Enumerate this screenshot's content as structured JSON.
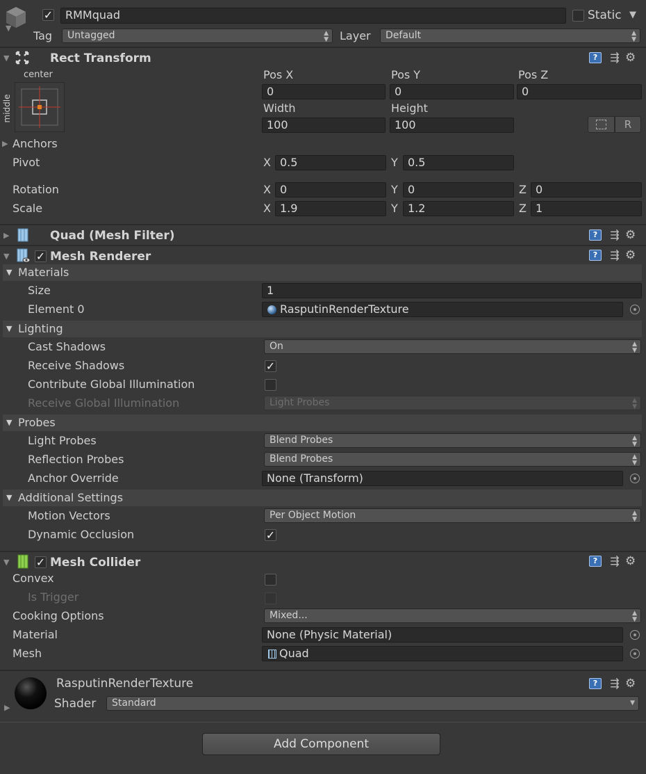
{
  "gameobject": {
    "name": "RMMquad",
    "static_label": "Static",
    "tag_label": "Tag",
    "tag_value": "Untagged",
    "layer_label": "Layer",
    "layer_value": "Default"
  },
  "rect_transform": {
    "title": "Rect Transform",
    "anchor_h": "center",
    "anchor_v": "middle",
    "pos_x_label": "Pos X",
    "pos_y_label": "Pos Y",
    "pos_z_label": "Pos Z",
    "pos_x": "0",
    "pos_y": "0",
    "pos_z": "0",
    "width_label": "Width",
    "height_label": "Height",
    "width": "100",
    "height": "100",
    "r_button": "R",
    "anchors_label": "Anchors",
    "pivot_label": "Pivot",
    "pivot_x": "0.5",
    "pivot_y": "0.5",
    "rotation_label": "Rotation",
    "rot_x": "0",
    "rot_y": "0",
    "rot_z": "0",
    "scale_label": "Scale",
    "scale_x": "1.9",
    "scale_y": "1.2",
    "scale_z": "1",
    "x": "X",
    "y": "Y",
    "z": "Z"
  },
  "mesh_filter": {
    "title": "Quad (Mesh Filter)"
  },
  "mesh_renderer": {
    "title": "Mesh Renderer",
    "materials_label": "Materials",
    "size_label": "Size",
    "size_value": "1",
    "element0_label": "Element 0",
    "element0_value": "RasputinRenderTexture",
    "lighting_label": "Lighting",
    "cast_shadows_label": "Cast Shadows",
    "cast_shadows_value": "On",
    "receive_shadows_label": "Receive Shadows",
    "contribute_gi_label": "Contribute Global Illumination",
    "receive_gi_label": "Receive Global Illumination",
    "receive_gi_value": "Light Probes",
    "probes_label": "Probes",
    "light_probes_label": "Light Probes",
    "light_probes_value": "Blend Probes",
    "reflection_probes_label": "Reflection Probes",
    "reflection_probes_value": "Blend Probes",
    "anchor_override_label": "Anchor Override",
    "anchor_override_value": "None (Transform)",
    "additional_label": "Additional Settings",
    "motion_vectors_label": "Motion Vectors",
    "motion_vectors_value": "Per Object Motion",
    "dynamic_occlusion_label": "Dynamic Occlusion"
  },
  "mesh_collider": {
    "title": "Mesh Collider",
    "convex_label": "Convex",
    "is_trigger_label": "Is Trigger",
    "cooking_label": "Cooking Options",
    "cooking_value": "Mixed...",
    "material_label": "Material",
    "material_value": "None (Physic Material)",
    "mesh_label": "Mesh",
    "mesh_value": "Quad"
  },
  "material": {
    "name": "RasputinRenderTexture",
    "shader_label": "Shader",
    "shader_value": "Standard"
  },
  "add_component": "Add Component",
  "icons": {
    "help": "?",
    "checkmark": "✓",
    "arrows": "▲▼",
    "colors": {
      "background": "#383838",
      "field": "#2a2a2a",
      "help": "#3a6fb3"
    }
  }
}
